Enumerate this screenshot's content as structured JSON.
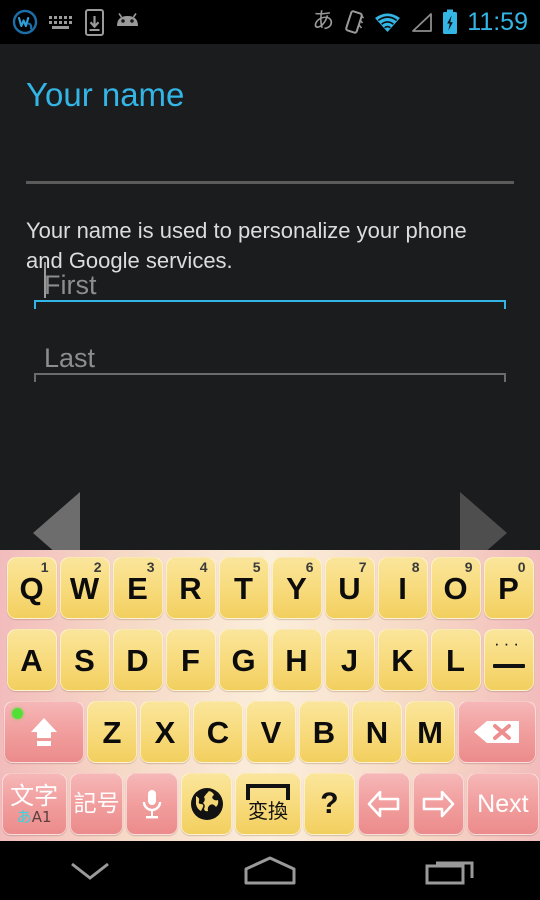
{
  "status_bar": {
    "left_icons": [
      {
        "name": "weave-app-icon",
        "glyph": "w-circle"
      },
      {
        "name": "keyboard-icon",
        "glyph": "keyboard"
      },
      {
        "name": "download-to-phone-icon",
        "glyph": "phone-download"
      },
      {
        "name": "android-icon",
        "glyph": "android-head"
      }
    ],
    "ime_indicator": "あ",
    "right_icons": [
      {
        "name": "vibrate-icon",
        "glyph": "vibrate"
      },
      {
        "name": "wifi-icon",
        "glyph": "wifi"
      },
      {
        "name": "signal-icon",
        "glyph": "signal-empty"
      },
      {
        "name": "battery-charging-icon",
        "glyph": "battery-charging"
      }
    ],
    "clock": "11:59",
    "accent_color": "#33b5e5"
  },
  "content": {
    "title": "Your name",
    "title_color": "#33b5e5",
    "description": "Your name is used to personalize your phone and Google services.",
    "fields": [
      {
        "name": "first-name-input",
        "placeholder": "First",
        "value": "",
        "focused": true,
        "underline_color": "#33b5e5"
      },
      {
        "name": "last-name-input",
        "placeholder": "Last",
        "value": "",
        "focused": false,
        "underline_color": "#6b6b6b"
      }
    ],
    "nav_prev_label": "Back",
    "nav_next_label": "Next"
  },
  "keyboard": {
    "background_edge_color": "#f2bcbc",
    "background_center_color": "#fbeedb",
    "key_color": "#f8dc80",
    "special_key_color": "#f2a0a0",
    "rows": [
      {
        "name": "row-qwerty",
        "keys": [
          {
            "label": "Q",
            "sub": "1",
            "type": "letter"
          },
          {
            "label": "W",
            "sub": "2",
            "type": "letter"
          },
          {
            "label": "E",
            "sub": "3",
            "type": "letter"
          },
          {
            "label": "R",
            "sub": "4",
            "type": "letter"
          },
          {
            "label": "T",
            "sub": "5",
            "type": "letter"
          },
          {
            "label": "Y",
            "sub": "6",
            "type": "letter"
          },
          {
            "label": "U",
            "sub": "7",
            "type": "letter"
          },
          {
            "label": "I",
            "sub": "8",
            "type": "letter"
          },
          {
            "label": "O",
            "sub": "9",
            "type": "letter"
          },
          {
            "label": "P",
            "sub": "0",
            "type": "letter"
          }
        ]
      },
      {
        "name": "row-asdf",
        "keys": [
          {
            "label": "A",
            "sub": "",
            "type": "letter"
          },
          {
            "label": "S",
            "sub": "",
            "type": "letter"
          },
          {
            "label": "D",
            "sub": "",
            "type": "letter"
          },
          {
            "label": "F",
            "sub": "",
            "type": "letter"
          },
          {
            "label": "G",
            "sub": "",
            "type": "letter"
          },
          {
            "label": "H",
            "sub": "",
            "type": "letter"
          },
          {
            "label": "J",
            "sub": "",
            "type": "letter"
          },
          {
            "label": "K",
            "sub": "",
            "type": "letter"
          },
          {
            "label": "L",
            "sub": "",
            "type": "letter"
          },
          {
            "label": "",
            "sub": "",
            "type": "hyphen",
            "icon": "hyphen-more-icon"
          }
        ]
      },
      {
        "name": "row-zxcv",
        "keys": [
          {
            "label": "",
            "sub": "",
            "type": "shift",
            "icon": "shift-caps-icon"
          },
          {
            "label": "Z",
            "sub": "",
            "type": "letter"
          },
          {
            "label": "X",
            "sub": "",
            "type": "letter"
          },
          {
            "label": "C",
            "sub": "",
            "type": "letter"
          },
          {
            "label": "V",
            "sub": "",
            "type": "letter"
          },
          {
            "label": "B",
            "sub": "",
            "type": "letter"
          },
          {
            "label": "N",
            "sub": "",
            "type": "letter"
          },
          {
            "label": "M",
            "sub": "",
            "type": "letter"
          },
          {
            "label": "",
            "sub": "",
            "type": "backspace",
            "icon": "backspace-icon"
          }
        ]
      },
      {
        "name": "row-bottom",
        "keys": [
          {
            "label": "文字",
            "sub": "あA1",
            "type": "mode",
            "icon": "input-mode-icon"
          },
          {
            "label": "記号",
            "sub": "",
            "type": "symbols",
            "icon": "symbols-icon"
          },
          {
            "label": "",
            "sub": "",
            "type": "mic",
            "icon": "microphone-icon"
          },
          {
            "label": "",
            "sub": "",
            "type": "globe",
            "icon": "globe-icon"
          },
          {
            "label": "変換",
            "sub": "",
            "type": "convert",
            "icon": "space-convert-icon"
          },
          {
            "label": "?",
            "sub": "",
            "type": "question"
          },
          {
            "label": "",
            "sub": "",
            "type": "arrow-left",
            "icon": "arrow-left-icon"
          },
          {
            "label": "",
            "sub": "",
            "type": "arrow-right",
            "icon": "arrow-right-icon"
          },
          {
            "label": "Next",
            "sub": "",
            "type": "enter"
          }
        ]
      }
    ]
  },
  "nav_bar": {
    "buttons": [
      {
        "name": "hide-keyboard-button",
        "icon": "chevron-down-icon",
        "label": "Hide keyboard"
      },
      {
        "name": "home-button",
        "icon": "home-icon",
        "label": "Home"
      },
      {
        "name": "recents-button",
        "icon": "recents-icon",
        "label": "Recent apps"
      }
    ],
    "icon_color": "#9a9a9a"
  }
}
